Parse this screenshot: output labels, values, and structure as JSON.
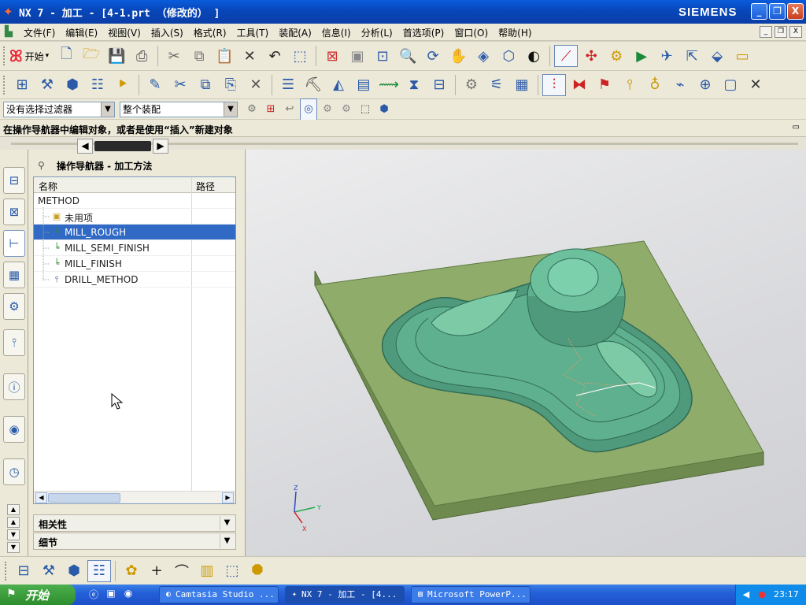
{
  "window": {
    "title": "NX 7 - 加工 - [4-1.prt （修改的） ]",
    "brand": "SIEMENS",
    "controls": {
      "minimize": "_",
      "restore": "❐",
      "close": "X"
    }
  },
  "menubar": {
    "items": [
      "文件(F)",
      "编辑(E)",
      "视图(V)",
      "插入(S)",
      "格式(R)",
      "工具(T)",
      "装配(A)",
      "信息(I)",
      "分析(L)",
      "首选项(P)",
      "窗口(O)",
      "帮助(H)"
    ],
    "mdi": {
      "minimize": "_",
      "restore": "❐",
      "close": "X"
    }
  },
  "toolbar": {
    "start_label": "开始",
    "start_arrow": "▾",
    "filter_combo": "没有选择过滤器",
    "assembly_combo": "整个装配",
    "combo_arrow": "▼"
  },
  "cue_line": "在操作导航器中编辑对象，或者是使用“插入”新建对象",
  "navigator": {
    "title": "操作导航器 - 加工方法",
    "columns": [
      "名称",
      "路径"
    ],
    "rows": [
      {
        "label": "METHOD",
        "indent": 0,
        "icon": "root",
        "selected": false
      },
      {
        "label": "未用项",
        "indent": 1,
        "icon": "folder",
        "selected": false
      },
      {
        "label": "MILL_ROUGH",
        "indent": 1,
        "icon": "mill-method",
        "selected": true
      },
      {
        "label": "MILL_SEMI_FINISH",
        "indent": 1,
        "icon": "mill-method",
        "selected": false
      },
      {
        "label": "MILL_FINISH",
        "indent": 1,
        "icon": "mill-method",
        "selected": false
      },
      {
        "label": "DRILL_METHOD",
        "indent": 1,
        "icon": "drill-method",
        "selected": false
      }
    ],
    "sections": [
      "相关性",
      "细节"
    ]
  },
  "viewport": {
    "axes": {
      "x": "X",
      "y": "Y",
      "z": "Z"
    },
    "colors": {
      "stock": "#8fac6a",
      "stock_side": "#6e8a4e",
      "part": "#5fb08e",
      "part_dark": "#3f8a6c",
      "background": "#e0e1e3"
    }
  },
  "taskbar": {
    "start_label": "开始",
    "tasks": [
      {
        "label": "Camtasia Studio ...",
        "icon": "camtasia-icon",
        "active": false
      },
      {
        "label": "NX 7 - 加工 - [4...",
        "icon": "nx-icon",
        "active": true
      },
      {
        "label": "Microsoft PowerP...",
        "icon": "powerpoint-icon",
        "active": false
      }
    ],
    "clock": "23:17"
  }
}
